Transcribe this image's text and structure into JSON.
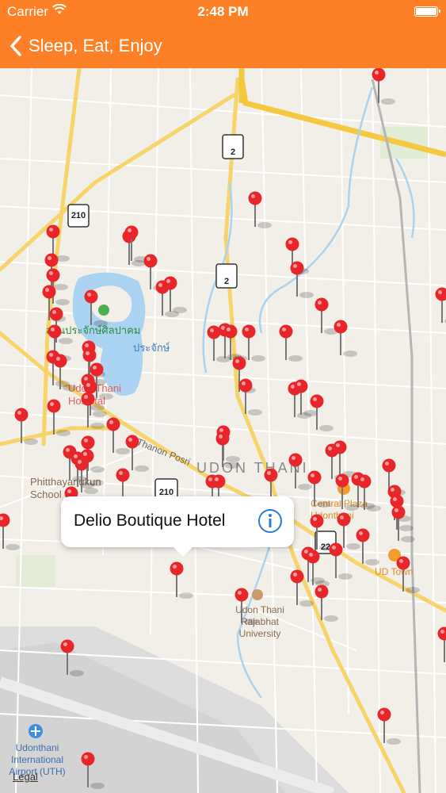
{
  "status_bar": {
    "carrier": "Carrier",
    "time": "2:48 PM",
    "wifi_icon": "wifi-icon",
    "battery_icon": "battery-icon"
  },
  "nav": {
    "back_label": "Sleep, Eat, Enjoy",
    "back_icon": "chevron-left-icon"
  },
  "map": {
    "labels": {
      "city": "UDON THANI",
      "hospital": "Udon Thani Hospital",
      "school": "Phitthayanukun School",
      "thai_park": "สวนประจักษ์ศิลปาคม",
      "thai_short": "ประจักษ์",
      "street": "Thanon Posri",
      "central_plaza": "Central Plaza Udonthani",
      "ud_town": "UD Town",
      "university": "Udon Thani Rajabhat University",
      "airport": "Udonthani International Airport (UTH)"
    },
    "route_shields": [
      "210",
      "2",
      "2",
      "210",
      "22"
    ],
    "legal": "Legal"
  },
  "callout": {
    "title": "Delio Boutique Hotel",
    "info_icon": "info-icon"
  },
  "colors": {
    "accent": "#fd7f26",
    "pin": "#e8262a",
    "water": "#a9d3f0",
    "major_road": "#f7d46a",
    "highway": "#f5c842",
    "info_blue": "#2a7ad9"
  }
}
